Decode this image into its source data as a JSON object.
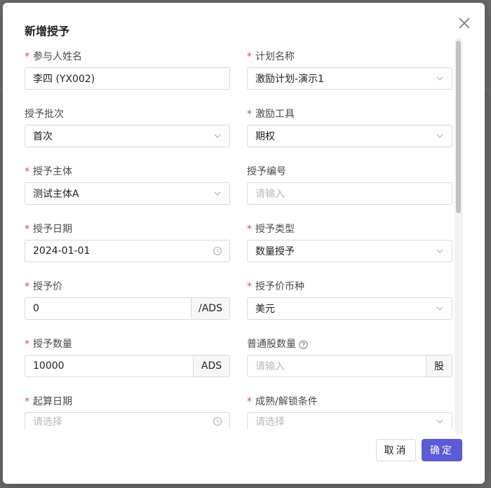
{
  "dialog": {
    "title": "新增授予",
    "close_label": "×"
  },
  "fields": {
    "participant_name": {
      "label": "参与人姓名",
      "required": true,
      "value": "李四 (YX002)"
    },
    "plan_name": {
      "label": "计划名称",
      "required": true,
      "value": "激励计划-演示1"
    },
    "grant_batch": {
      "label": "授予批次",
      "required": false,
      "value": "首次"
    },
    "incentive_tool": {
      "label": "激励工具",
      "required": true,
      "value": "期权"
    },
    "grant_entity": {
      "label": "授予主体",
      "required": true,
      "value": "测试主体A"
    },
    "grant_number": {
      "label": "授予编号",
      "required": false,
      "placeholder": "请输入"
    },
    "grant_date": {
      "label": "授予日期",
      "required": true,
      "value": "2024-01-01"
    },
    "grant_type": {
      "label": "授予类型",
      "required": true,
      "value": "数量授予"
    },
    "grant_price": {
      "label": "授予价",
      "required": true,
      "value": "0",
      "addon": "/ADS"
    },
    "price_currency": {
      "label": "授予价币种",
      "required": true,
      "value": "美元"
    },
    "grant_quantity": {
      "label": "授予数量",
      "required": true,
      "value": "10000",
      "addon": "ADS"
    },
    "common_share_quantity": {
      "label": "普通股数量",
      "required": false,
      "placeholder": "请输入",
      "addon": "股"
    },
    "start_date": {
      "label": "起算日期",
      "required": true,
      "placeholder": "请选择"
    },
    "vesting_condition": {
      "label": "成熟/解锁条件",
      "required": true,
      "placeholder": "请选择"
    }
  },
  "required_mark": "*",
  "footer": {
    "cancel_label": "取消",
    "ok_label": "确定"
  },
  "colors": {
    "primary": "#5b5bd6",
    "required": "#e5484d",
    "border": "#d9d9d9",
    "placeholder": "#b8b8b8"
  },
  "icons": {
    "select_suffix": "chevron-down-icon",
    "date_suffix": "clock-icon",
    "help": "question-circle-icon",
    "close": "close-icon"
  }
}
